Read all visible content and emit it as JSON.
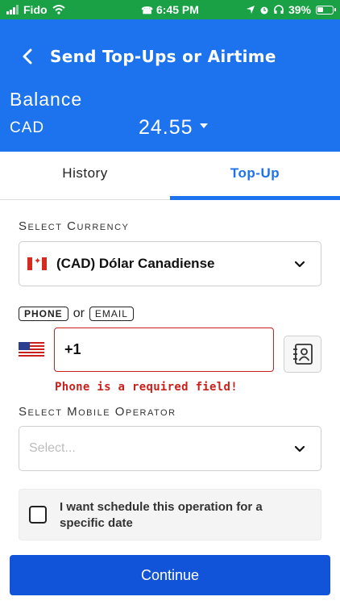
{
  "status_bar": {
    "carrier": "Fido",
    "time": "6:45 PM",
    "battery": "39%",
    "icons": [
      "signal-icon",
      "wifi-icon",
      "phone-icon",
      "location-icon",
      "alarm-icon",
      "headphones-icon",
      "battery-icon"
    ]
  },
  "header": {
    "title": "Send Top-Ups or Airtime",
    "balance_label": "Balance",
    "currency_code": "CAD",
    "balance_amount": "24.55"
  },
  "tabs": [
    {
      "label": "History",
      "active": false
    },
    {
      "label": "Top-Up",
      "active": true
    }
  ],
  "form": {
    "currency_label": "Select Currency",
    "currency_value": "(CAD) Dólar Canadiense",
    "contact_types": [
      "PHONE",
      "EMAIL"
    ],
    "or_text": "or",
    "phone_value": "+1",
    "phone_error": "Phone is a required field!",
    "operator_label": "Select Mobile Operator",
    "operator_placeholder": "Select...",
    "schedule_text": "I want schedule this operation for a specific date",
    "continue_label": "Continue"
  },
  "colors": {
    "status_bar": "#1aa146",
    "header": "#1d73ee",
    "accent": "#1d73ee",
    "error": "#c9201c",
    "button": "#1254d9"
  }
}
